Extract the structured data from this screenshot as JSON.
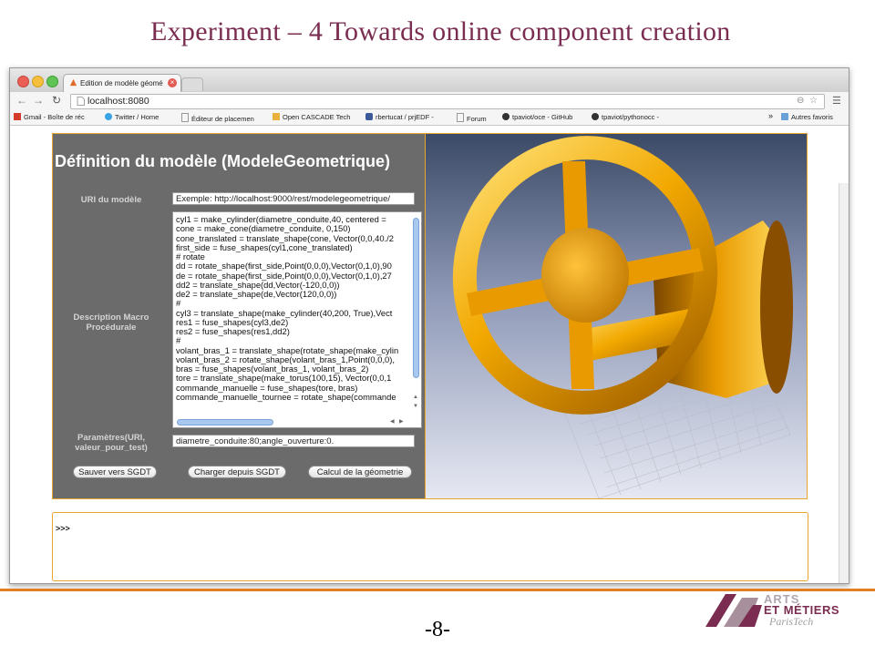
{
  "slide": {
    "title": "Experiment – 4 Towards online component creation",
    "page_number": "-8-",
    "logo": {
      "line1": "ARTS",
      "line2": "ET MÉTIERS",
      "line3": "ParisTech"
    }
  },
  "browser": {
    "tab_title": "Edition de modèle géomé",
    "address": "localhost:8080",
    "bookmarks": [
      {
        "label": "Gmail - Boîte de réc",
        "icon": "gmail-icon"
      },
      {
        "label": "Twitter / Home",
        "icon": "twitter-icon"
      },
      {
        "label": "Éditeur de placemen",
        "icon": "page-icon"
      },
      {
        "label": "Open CASCADE Tech",
        "icon": "occ-icon"
      },
      {
        "label": "rbertucat / prjEDF -",
        "icon": "shield-icon"
      },
      {
        "label": "Forum",
        "icon": "page-icon"
      },
      {
        "label": "tpaviot/oce - GitHub",
        "icon": "github-icon"
      },
      {
        "label": "tpaviot/pythonocc -",
        "icon": "github-icon"
      }
    ],
    "bookmarks_overflow": "»",
    "other_bookmarks": "Autres favoris"
  },
  "app": {
    "heading": "Définition du modèle (ModeleGeometrique)",
    "uri_label": "URI du modèle",
    "uri_placeholder": "Exemple: http://localhost:9000/rest/modelegeometrique/",
    "description_label": "Description Macro Procédurale",
    "code_lines": [
      "cyl1 = make_cylinder(diametre_conduite,40, centered =",
      "cone = make_cone(diametre_conduite, 0,150)",
      "cone_translated = translate_shape(cone, Vector(0,0,40./2",
      "first_side = fuse_shapes(cyl1,cone_translated)",
      "# rotate",
      "dd = rotate_shape(first_side,Point(0,0,0),Vector(0,1,0),90",
      "de = rotate_shape(first_side,Point(0,0,0),Vector(0,1,0),27",
      "dd2 = translate_shape(dd,Vector(-120,0,0))",
      "de2 = translate_shape(de,Vector(120,0,0))",
      "#",
      "cyl3 = translate_shape(make_cylinder(40,200, True),Vect",
      "res1 = fuse_shapes(cyl3,de2)",
      "res2 = fuse_shapes(res1,dd2)",
      "#",
      "volant_bras_1 = translate_shape(rotate_shape(make_cylin",
      "volant_bras_2 = rotate_shape(volant_bras_1,Point(0,0,0),",
      "bras = fuse_shapes(volant_bras_1, volant_bras_2)",
      "tore = translate_shape(make_torus(100,15), Vector(0,0,1",
      "commande_manuelle = fuse_shapes(tore, bras)",
      "commande_manuelle_tournee = rotate_shape(commande"
    ],
    "params_label": "Paramètres(URI, valeur_pour_test)",
    "params_value": "diametre_conduite:80;angle_ouverture:0.",
    "buttons": {
      "save": "Sauver vers SGDT",
      "load": "Charger depuis SGDT",
      "compute": "Calcul de la géometrie"
    },
    "console_prompt": ">>>"
  },
  "colors": {
    "title": "#7a2d50",
    "accent_orange": "#e8a62d",
    "panel_gray": "#6b6b6b",
    "wheel_gold": "#f0a800"
  }
}
